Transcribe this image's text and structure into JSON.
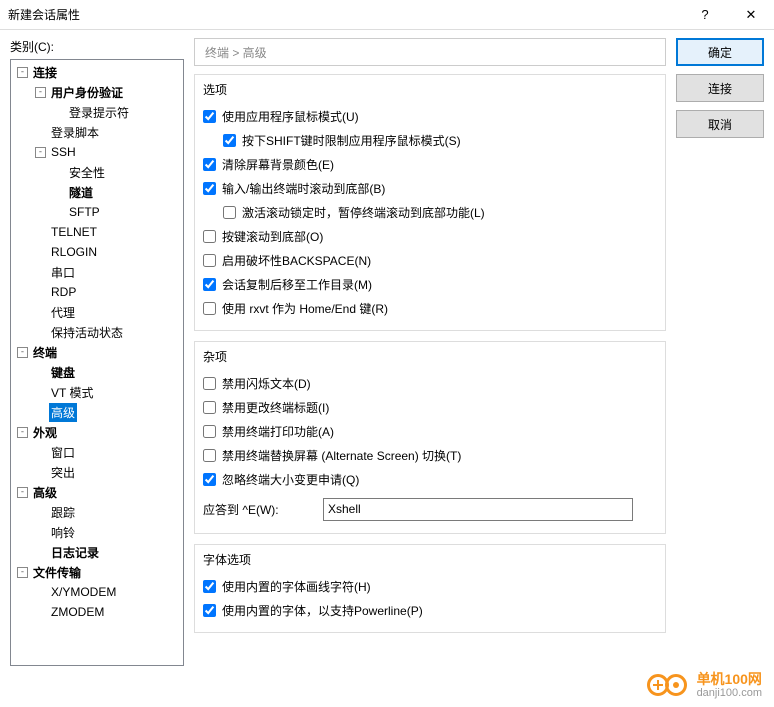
{
  "titlebar": {
    "title": "新建会话属性"
  },
  "category_label": "类别(C):",
  "breadcrumb": "终端 > 高级",
  "tree": [
    {
      "d": 0,
      "t": "-",
      "b": true,
      "lbl": "连接"
    },
    {
      "d": 1,
      "t": "-",
      "b": true,
      "lbl": "用户身份验证"
    },
    {
      "d": 2,
      "t": "",
      "b": false,
      "lbl": "登录提示符"
    },
    {
      "d": 1,
      "t": "",
      "b": false,
      "lbl": "登录脚本"
    },
    {
      "d": 1,
      "t": "-",
      "b": false,
      "lbl": "SSH"
    },
    {
      "d": 2,
      "t": "",
      "b": false,
      "lbl": "安全性"
    },
    {
      "d": 2,
      "t": "",
      "b": true,
      "lbl": "隧道"
    },
    {
      "d": 2,
      "t": "",
      "b": false,
      "lbl": "SFTP"
    },
    {
      "d": 1,
      "t": "",
      "b": false,
      "lbl": "TELNET"
    },
    {
      "d": 1,
      "t": "",
      "b": false,
      "lbl": "RLOGIN"
    },
    {
      "d": 1,
      "t": "",
      "b": false,
      "lbl": "串口"
    },
    {
      "d": 1,
      "t": "",
      "b": false,
      "lbl": "RDP"
    },
    {
      "d": 1,
      "t": "",
      "b": false,
      "lbl": "代理"
    },
    {
      "d": 1,
      "t": "",
      "b": false,
      "lbl": "保持活动状态"
    },
    {
      "d": 0,
      "t": "-",
      "b": true,
      "lbl": "终端"
    },
    {
      "d": 1,
      "t": "",
      "b": true,
      "lbl": "键盘"
    },
    {
      "d": 1,
      "t": "",
      "b": false,
      "lbl": "VT 模式"
    },
    {
      "d": 1,
      "t": "",
      "b": false,
      "lbl": "高级",
      "sel": true
    },
    {
      "d": 0,
      "t": "-",
      "b": true,
      "lbl": "外观"
    },
    {
      "d": 1,
      "t": "",
      "b": false,
      "lbl": "窗口"
    },
    {
      "d": 1,
      "t": "",
      "b": false,
      "lbl": "突出"
    },
    {
      "d": 0,
      "t": "-",
      "b": true,
      "lbl": "高级"
    },
    {
      "d": 1,
      "t": "",
      "b": false,
      "lbl": "跟踪"
    },
    {
      "d": 1,
      "t": "",
      "b": false,
      "lbl": "响铃"
    },
    {
      "d": 1,
      "t": "",
      "b": true,
      "lbl": "日志记录"
    },
    {
      "d": 0,
      "t": "-",
      "b": true,
      "lbl": "文件传输"
    },
    {
      "d": 1,
      "t": "",
      "b": false,
      "lbl": "X/YMODEM"
    },
    {
      "d": 1,
      "t": "",
      "b": false,
      "lbl": "ZMODEM"
    }
  ],
  "options": {
    "legend": "选项",
    "items": [
      {
        "c": true,
        "i": 0,
        "lbl": "使用应用程序鼠标模式(U)"
      },
      {
        "c": true,
        "i": 1,
        "lbl": "按下SHIFT键时限制应用程序鼠标模式(S)"
      },
      {
        "c": true,
        "i": 0,
        "lbl": "清除屏幕背景颜色(E)"
      },
      {
        "c": true,
        "i": 0,
        "lbl": "输入/输出终端时滚动到底部(B)"
      },
      {
        "c": false,
        "i": 1,
        "lbl": "激活滚动锁定时，暂停终端滚动到底部功能(L)"
      },
      {
        "c": false,
        "i": 0,
        "lbl": "按键滚动到底部(O)"
      },
      {
        "c": false,
        "i": 0,
        "lbl": "启用破坏性BACKSPACE(N)"
      },
      {
        "c": true,
        "i": 0,
        "lbl": "会话复制后移至工作目录(M)"
      },
      {
        "c": false,
        "i": 0,
        "lbl": "使用 rxvt 作为 Home/End 键(R)"
      }
    ]
  },
  "misc": {
    "legend": "杂项",
    "items": [
      {
        "c": false,
        "lbl": "禁用闪烁文本(D)"
      },
      {
        "c": false,
        "lbl": "禁用更改终端标题(I)"
      },
      {
        "c": false,
        "lbl": "禁用终端打印功能(A)"
      },
      {
        "c": false,
        "lbl": "禁用终端替换屏幕 (Alternate Screen) 切换(T)"
      },
      {
        "c": true,
        "lbl": "忽略终端大小变更申请(Q)"
      }
    ],
    "answer_label": "应答到 ^E(W):",
    "answer_value": "Xshell"
  },
  "font": {
    "legend": "字体选项",
    "items": [
      {
        "c": true,
        "lbl": "使用内置的字体画线字符(H)"
      },
      {
        "c": true,
        "lbl": "使用内置的字体，以支持Powerline(P)"
      }
    ]
  },
  "buttons": {
    "ok": "确定",
    "connect": "连接",
    "cancel": "取消"
  },
  "watermark": {
    "l1": "单机100网",
    "l2": "danji100.com"
  }
}
